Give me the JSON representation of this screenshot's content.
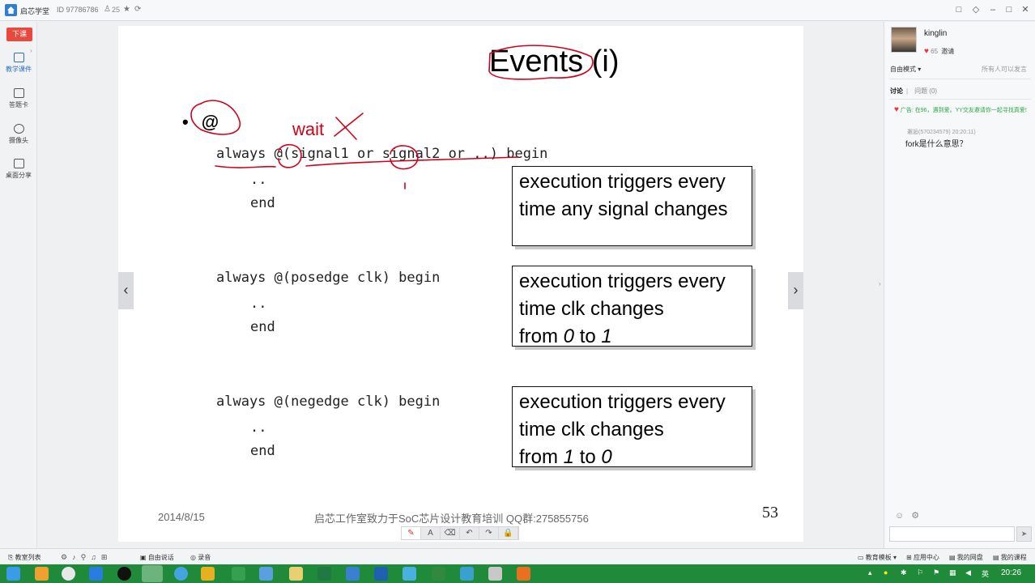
{
  "titlebar": {
    "app_name": "启芯学堂",
    "room_id": "ID 97786786",
    "online_count": "25",
    "buttons": [
      "□",
      "◇",
      "–",
      "□",
      "✕"
    ]
  },
  "leftbar": {
    "end_class_label": "下课",
    "items": [
      {
        "label": "教学课件",
        "icon": "courseware-icon"
      },
      {
        "label": "答题卡",
        "icon": "answer-card-icon"
      },
      {
        "label": "摄像头",
        "icon": "camera-icon"
      },
      {
        "label": "桌面分享",
        "icon": "screen-share-icon"
      }
    ]
  },
  "slide": {
    "title": "Events (i)",
    "bullet": "@",
    "annotation": "wait",
    "code_blocks": [
      {
        "line1": "always @(signal1 or signal2 or ..) begin",
        "line2": "..",
        "line3": "end"
      },
      {
        "line1": "always @(posedge clk) begin",
        "line2": "..",
        "line3": "end"
      },
      {
        "line1": "always @(negedge clk) begin",
        "line2": "..",
        "line3": "end"
      }
    ],
    "boxes": [
      {
        "l1": "execution triggers every",
        "l2": "time any signal changes",
        "l3": ""
      },
      {
        "l1": "execution triggers every",
        "l2": "time clk changes",
        "l3a": "from ",
        "l3b": "0",
        "l3c": " to ",
        "l3d": "1"
      },
      {
        "l1": "execution triggers every",
        "l2": "time clk changes",
        "l3a": "from ",
        "l3b": "1",
        "l3c": " to ",
        "l3d": "0"
      }
    ],
    "footer_date": "2014/8/15",
    "footer_text": "启芯工作室致力于SoC芯片设计教育培训 QQ群:275855756",
    "page_number": "53",
    "prev_arrow": "‹",
    "next_arrow": "›"
  },
  "drawing_tools": [
    "✎",
    "A",
    "⌫",
    "↶",
    "↷",
    "🔒"
  ],
  "rightpanel": {
    "username": "kinglin",
    "likes": "65",
    "invite_label": "邀请",
    "mode_label": "自由模式 ▾",
    "mode_right": "所有人可以发言",
    "tab_discuss": "讨论",
    "tab_question": "问题 (0)",
    "ad_text": "广告: 在96，遇到爱。YY交友邀请你一起寻找真爱!",
    "msg_meta": "邂逅(570234579) 20:20:11)",
    "msg_text": "fork是什么意思？",
    "send_icon": "➤"
  },
  "bottombar": {
    "class_list": "教室列表",
    "free_talk": "自由说话",
    "record": "录音",
    "edu_template": "教育模板 ▾",
    "app_center": "应用中心",
    "my_disk": "我的网盘",
    "my_courses": "我的课程"
  },
  "taskbar": {
    "ime": "英",
    "time": "20:26"
  }
}
